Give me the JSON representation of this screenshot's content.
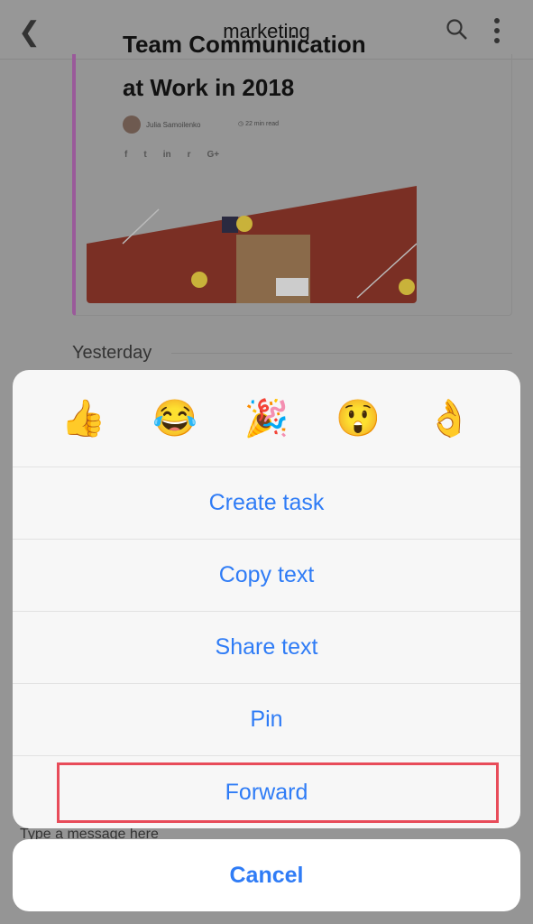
{
  "header": {
    "title": "marketing",
    "back_icon": "chevron-left-icon",
    "search_icon": "search-icon",
    "more_icon": "more-vertical-icon"
  },
  "article": {
    "title_partial": "Team Communication",
    "title_line": "at Work in 2018",
    "author": "Julia Samoilenko",
    "read_time": "22 min read",
    "social": [
      "f",
      "t",
      "in",
      "r",
      "G+"
    ]
  },
  "chat": {
    "date_divider": "Yesterday",
    "composer_placeholder": "Type a message here"
  },
  "sheet": {
    "reactions": [
      "👍",
      "😂",
      "🎉",
      "😲",
      "👌"
    ],
    "actions": [
      "Create task",
      "Copy text",
      "Share text",
      "Pin",
      "Forward"
    ],
    "cancel": "Cancel"
  },
  "colors": {
    "accent": "#2f7cf6",
    "highlight": "#e84c5a"
  }
}
